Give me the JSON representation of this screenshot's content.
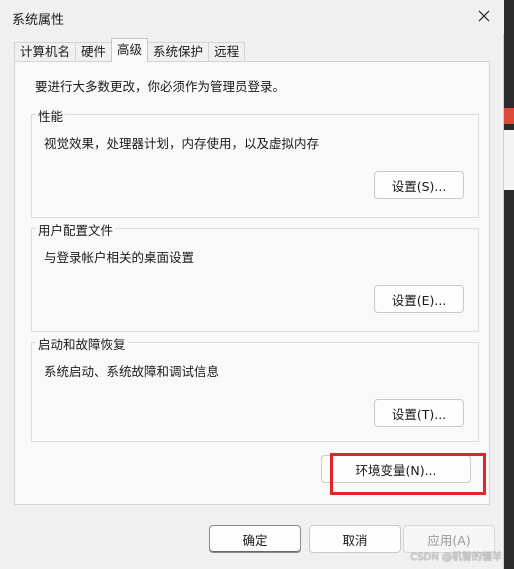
{
  "window": {
    "title": "系统属性"
  },
  "tabs": [
    {
      "label": "计算机名",
      "active": false
    },
    {
      "label": "硬件",
      "active": false
    },
    {
      "label": "高级",
      "active": true
    },
    {
      "label": "系统保护",
      "active": false
    },
    {
      "label": "远程",
      "active": false
    }
  ],
  "advanced": {
    "intro": "要进行大多数更改，你必须作为管理员登录。",
    "performance": {
      "title": "性能",
      "desc": "视觉效果，处理器计划，内存使用，以及虚拟内存",
      "button": "设置(S)..."
    },
    "user_profiles": {
      "title": "用户配置文件",
      "desc": "与登录帐户相关的桌面设置",
      "button": "设置(E)..."
    },
    "startup_recovery": {
      "title": "启动和故障恢复",
      "desc": "系统启动、系统故障和调试信息",
      "button": "设置(T)..."
    },
    "env_button": "环境变量(N)..."
  },
  "footer": {
    "ok": "确定",
    "cancel": "取消",
    "apply": "应用(A)"
  },
  "watermark": "CSDN @机智的慢羊",
  "colors": {
    "highlight": "#e3232a",
    "dialog_bg": "#f0f0f0",
    "panel_bg": "#f9f9f9"
  }
}
